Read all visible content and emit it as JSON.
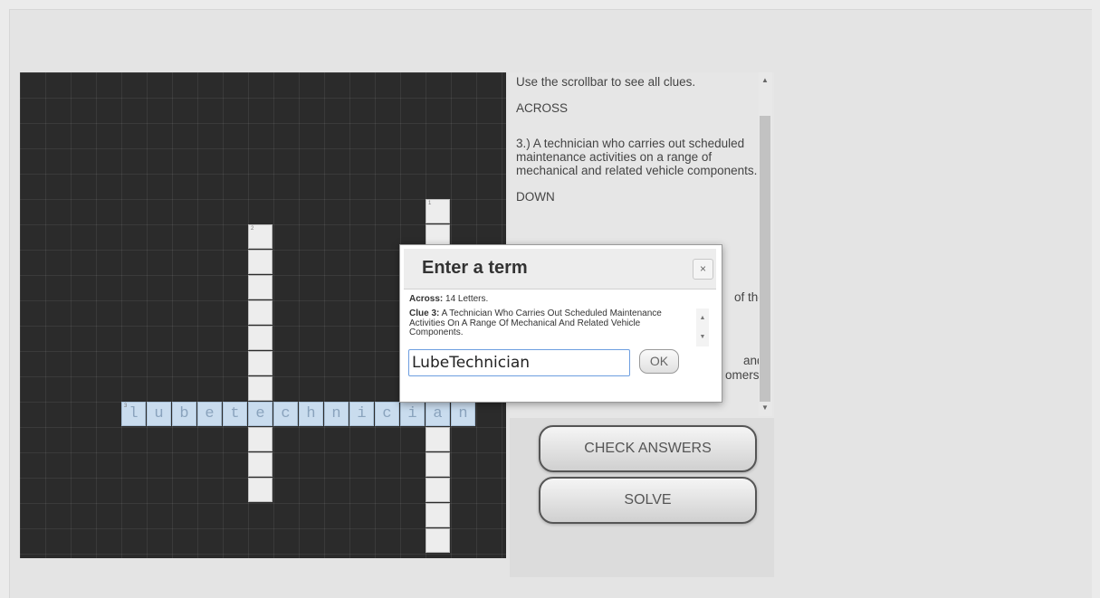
{
  "board": {
    "across_letters": [
      "l",
      "u",
      "b",
      "e",
      "t",
      "e",
      "c",
      "h",
      "n",
      "i",
      "c",
      "i",
      "a",
      "n"
    ],
    "cell_numbers": {
      "across_start": "3",
      "down_col_a": "2",
      "down_col_b": "1"
    }
  },
  "clues": {
    "intro": "Use the scrollbar to see all clues.",
    "across_header": "ACROSS",
    "across_clue": "3.) A technician who carries out scheduled maintenance activities on a range of mechanical and related vehicle components.",
    "down_header": "DOWN",
    "hidden_fragment_1": "of the",
    "hidden_fragment_2": "and",
    "hidden_fragment_3": "omers"
  },
  "buttons": {
    "check_answers": "CHECK ANSWERS",
    "solve": "SOLVE"
  },
  "modal": {
    "title": "Enter a term",
    "close_symbol": "×",
    "info_label": "Across:",
    "info_value": " 14 Letters.",
    "clue_label": "Clue 3:",
    "clue_text": " A Technician Who Carries Out Scheduled Maintenance Activities On A Range Of Mechanical And Related Vehicle Components.",
    "input_value": "LubeTechnician",
    "ok_label": "OK"
  }
}
